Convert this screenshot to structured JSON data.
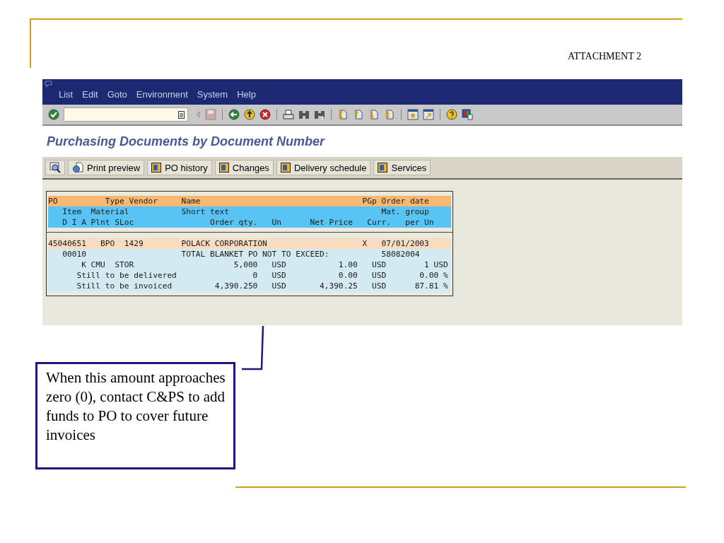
{
  "slide": {
    "label": "ATTACHMENT 2"
  },
  "window": {
    "menu": [
      {
        "label": "List"
      },
      {
        "label": "Edit"
      },
      {
        "label": "Goto"
      },
      {
        "label": "Environment"
      },
      {
        "label": "System"
      },
      {
        "label": "Help"
      }
    ],
    "title": "Purchasing Documents by Document Number",
    "app_toolbar": [
      {
        "kind": "preview",
        "label": "Print preview"
      },
      {
        "kind": "detail",
        "label": "PO history"
      },
      {
        "kind": "detail",
        "label": "Changes"
      },
      {
        "kind": "detail",
        "label": "Delivery schedule"
      },
      {
        "kind": "detail",
        "label": "Services"
      }
    ],
    "list": {
      "header": [
        {
          "kind": "po",
          "text": "PO          Type Vendor     Name                                  PGp Order date"
        },
        {
          "kind": "item",
          "text": "   Item  Material           Short text                                Mat. group"
        },
        {
          "kind": "item",
          "text": "   D I A Plnt SLoc                Order qty.   Un      Net Price   Curr.   per Un"
        }
      ],
      "rows": [
        {
          "kind": "po",
          "text": "45040651   BPO  1429        POLACK CORPORATION                    X   07/01/2003"
        },
        {
          "kind": "item",
          "text": "   00010                    TOTAL BLANKET PO NOT TO EXCEED:           58082004"
        },
        {
          "kind": "item",
          "text": "       K CMU  STOR                     5,000   USD           1.00   USD        1 USD"
        },
        {
          "kind": "item",
          "text": "      Still to be delivered                0   USD           0.00   USD       0.00 %"
        },
        {
          "kind": "item",
          "text": "      Still to be invoiced         4,390.250   USD       4,390.25   USD      87.81 %"
        }
      ]
    }
  },
  "callout": {
    "text": "When this amount approaches zero (0), contact C&PS to add funds to PO to cover future invoices"
  }
}
